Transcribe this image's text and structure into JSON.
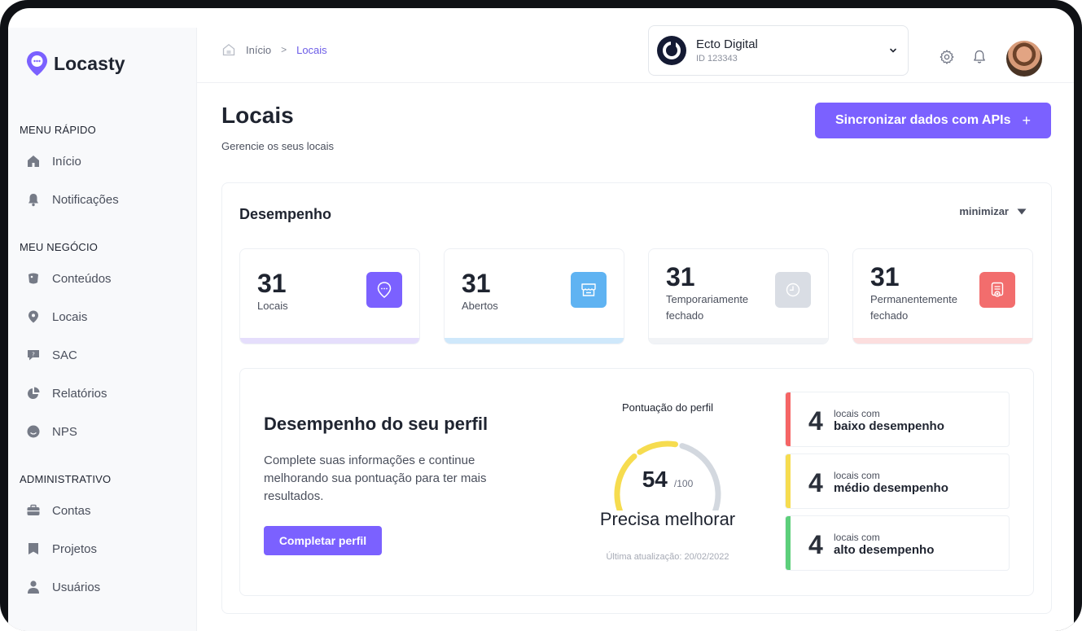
{
  "app": {
    "name": "Locasty"
  },
  "sidebar": {
    "sections": [
      {
        "label": "MENU RÁPIDO",
        "items": [
          "Início",
          "Notificações"
        ]
      },
      {
        "label": "MEU NEGÓCIO",
        "items": [
          "Conteúdos",
          "Locais",
          "SAC",
          "Relatórios",
          "NPS"
        ]
      },
      {
        "label": "ADMINISTRATIVO",
        "items": [
          "Contas",
          "Projetos",
          "Usuários"
        ]
      }
    ],
    "icons": {
      "Início": "home-icon",
      "Notificações": "bell-icon",
      "Conteúdos": "content-icon",
      "Locais": "location-pin-icon",
      "SAC": "support-chat-icon",
      "Relatórios": "pie-chart-icon",
      "NPS": "smiley-icon",
      "Contas": "briefcase-icon",
      "Projetos": "folder-icon",
      "Usuários": "user-icon"
    }
  },
  "breadcrumb": {
    "home": "Início",
    "separator": ">",
    "current": "Locais"
  },
  "account": {
    "name": "Ecto Digital",
    "id": "ID 123343"
  },
  "header": {
    "title": "Locais",
    "subtitle": "Gerencie os seus locais",
    "sync_button": "Sincronizar dados com APIs",
    "sync_plus": "+"
  },
  "performance": {
    "title": "Desempenho",
    "minimize": "minimizar",
    "stats": [
      {
        "value": "31",
        "label": "Locais",
        "icon": "location-chat-icon",
        "color": "#7b61ff",
        "bar": "#e5defc"
      },
      {
        "value": "31",
        "label": "Abertos",
        "icon": "store-icon",
        "color": "#5fb3f2",
        "bar": "#cfe8fb"
      },
      {
        "value": "31",
        "label": "Temporariamente fechado",
        "icon": "clock-icon",
        "color": "#d9dde4",
        "bar": "#f1f3f6"
      },
      {
        "value": "31",
        "label": "Permanentemente fechado",
        "icon": "closed-sign-icon",
        "color": "#f26d6d",
        "bar": "#fcdede"
      }
    ]
  },
  "profile": {
    "title": "Desempenho do seu perfil",
    "text": "Complete suas informações e continue melhorando sua pontuação para ter mais resultados.",
    "button": "Completar perfil",
    "score_label": "Pontuação do perfil",
    "score": "54",
    "score_max": "/100",
    "score_fraction": 0.54,
    "status": "Precisa melhorar",
    "last_update": "Última atualização: 20/02/2022",
    "colors": {
      "low": "#f56565",
      "mid": "#f6dc4f",
      "high": "#5ccf7a",
      "track": "#d3d8df"
    },
    "levels": [
      {
        "count": "4",
        "line1": "locais com",
        "line2": "baixo desempenho",
        "color": "#f56565"
      },
      {
        "count": "4",
        "line1": "locais com",
        "line2": "médio desempenho",
        "color": "#f6dc4f"
      },
      {
        "count": "4",
        "line1": "locais com",
        "line2": "alto desempenho",
        "color": "#5ccf7a"
      }
    ]
  }
}
